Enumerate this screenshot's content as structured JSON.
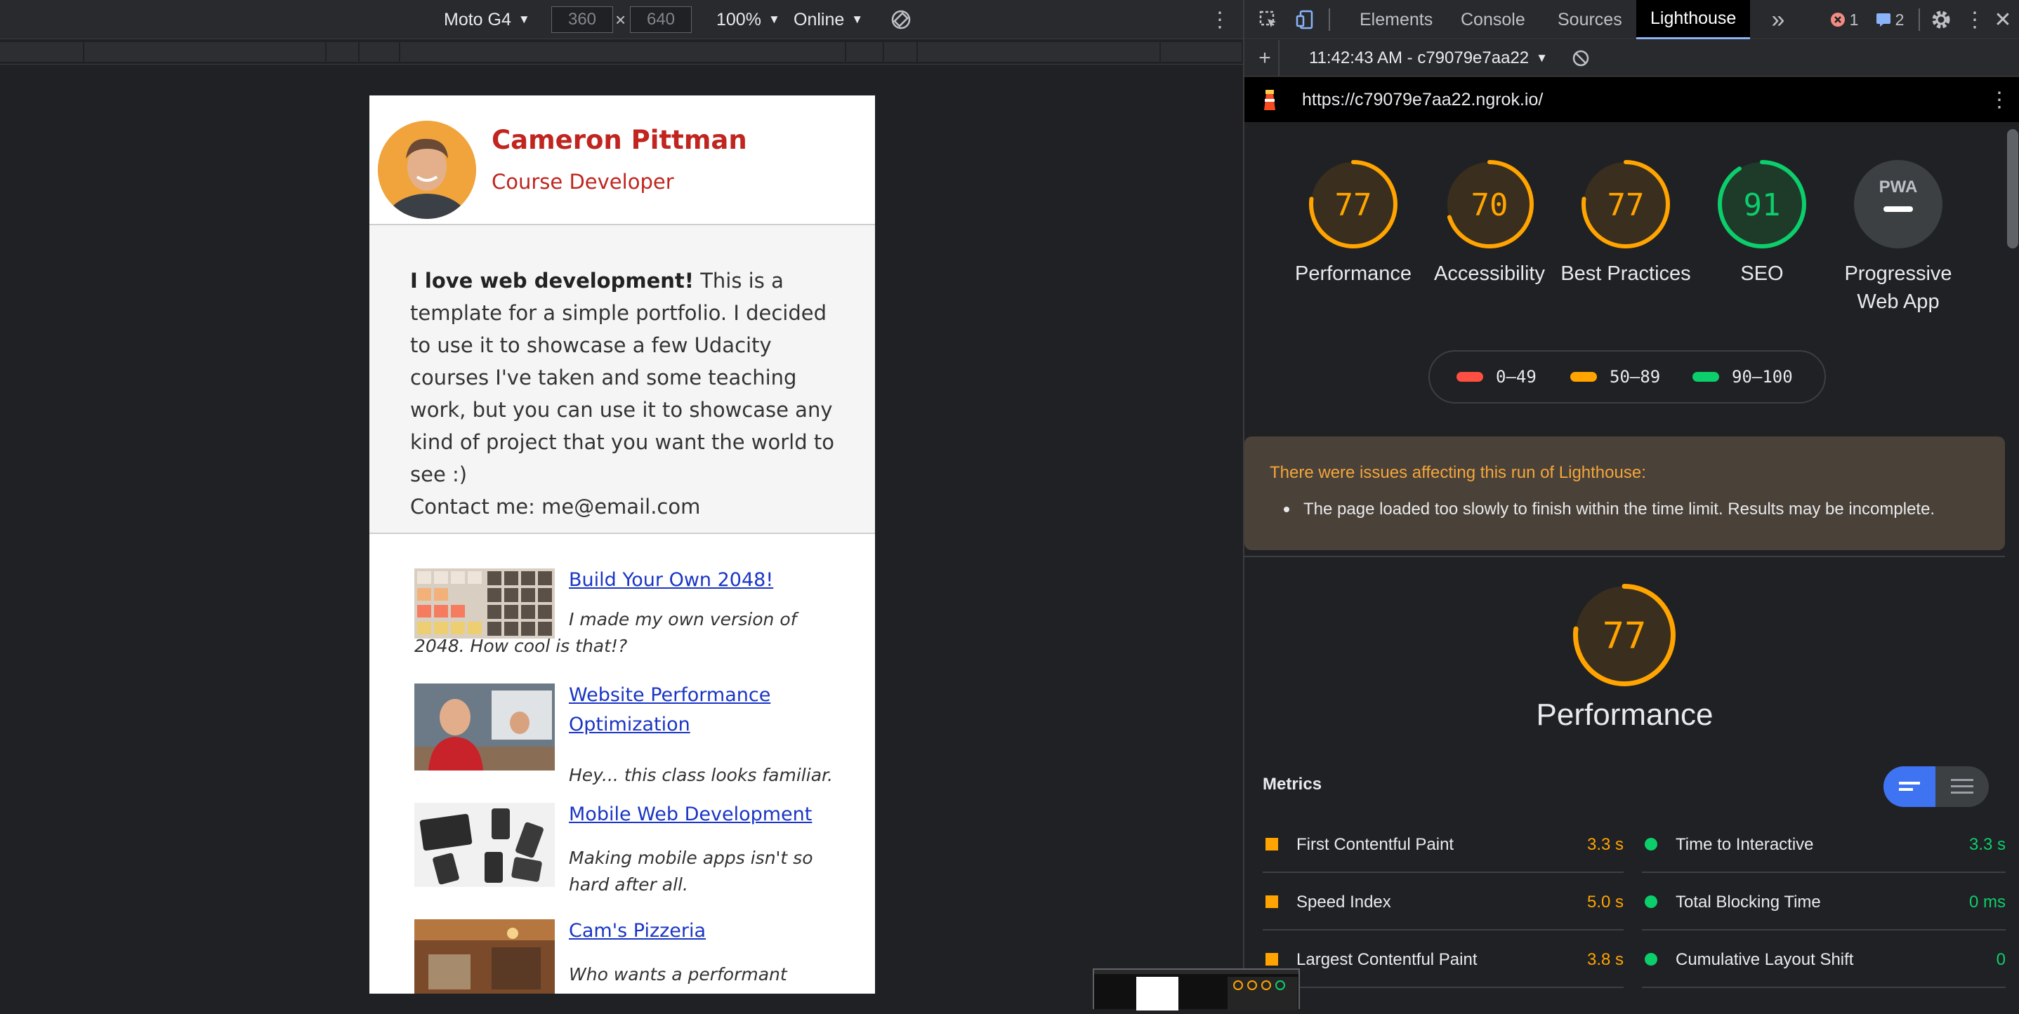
{
  "device_toolbar": {
    "device": "Moto G4",
    "width": "360",
    "times": "×",
    "height": "640",
    "zoom": "100%",
    "throttle": "Online"
  },
  "portfolio": {
    "name": "Cameron Pittman",
    "role": "Course Developer",
    "intro_bold": "I love web development!",
    "intro_text": " This is a template for a simple portfolio. I decided to use it to showcase a few Udacity courses I've taken and some teaching work, but you can use it to showcase any kind of project that you want the world to see :)",
    "contact": "Contact me: me@email.com",
    "projects": [
      {
        "title": "Build Your Own 2048!",
        "desc": "I made my own version of 2048. How cool is that!?"
      },
      {
        "title": "Website Performance Optimization",
        "desc": "Hey... this class looks familiar."
      },
      {
        "title": "Mobile Web Development",
        "desc": "Making mobile apps isn't so hard after all."
      },
      {
        "title": "Cam's Pizzeria",
        "desc": "Who wants a performant pizza?"
      }
    ]
  },
  "devtools": {
    "tabs": [
      "Elements",
      "Console",
      "Sources",
      "Lighthouse"
    ],
    "more": "»",
    "error_count": "1",
    "message_count": "2",
    "report_select": "11:42:43 AM - c79079e7aa22",
    "url": "https://c79079e7aa22.ngrok.io/"
  },
  "lighthouse": {
    "categories": [
      {
        "label": "Performance",
        "score": 77
      },
      {
        "label": "Accessibility",
        "score": 70
      },
      {
        "label": "Best Practices",
        "score": 77
      },
      {
        "label": "SEO",
        "score": 91
      },
      {
        "label": "Progressive Web App",
        "badge": "PWA"
      }
    ],
    "legend": [
      "0–49",
      "50–89",
      "90–100"
    ],
    "warning_title": "There were issues affecting this run of Lighthouse:",
    "warning_item": "The page loaded too slowly to finish within the time limit. Results may be incomplete.",
    "perf_score": 77,
    "perf_label": "Performance",
    "metrics_title": "Metrics",
    "metrics": [
      {
        "name": "First Contentful Paint",
        "value": "3.3 s",
        "status": "average"
      },
      {
        "name": "Time to Interactive",
        "value": "3.3 s",
        "status": "pass"
      },
      {
        "name": "Speed Index",
        "value": "5.0 s",
        "status": "average"
      },
      {
        "name": "Total Blocking Time",
        "value": "0 ms",
        "status": "pass"
      },
      {
        "name": "Largest Contentful Paint",
        "value": "3.8 s",
        "status": "average"
      },
      {
        "name": "Cumulative Layout Shift",
        "value": "0",
        "status": "pass"
      }
    ],
    "colors": {
      "pass": "#0cce6b",
      "average": "#ffa400",
      "fail": "#ff4e42"
    }
  }
}
